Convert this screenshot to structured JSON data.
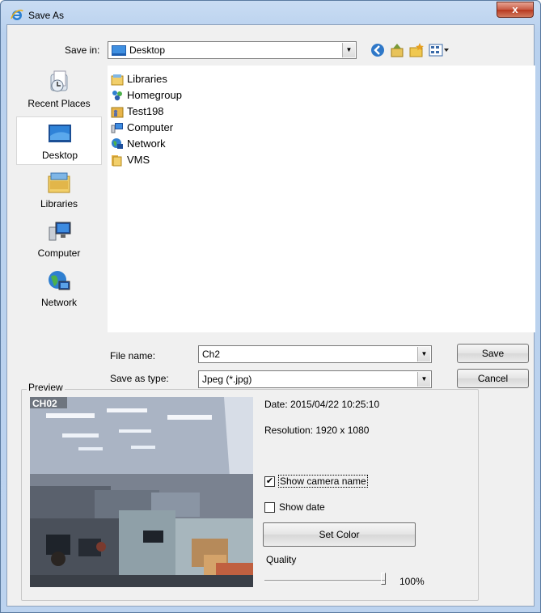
{
  "window": {
    "title": "Save As",
    "close_label": "x"
  },
  "toolbar": {
    "save_in_label": "Save in:",
    "save_in_value": "Desktop",
    "icons": [
      "back-icon",
      "up-folder-icon",
      "new-folder-icon",
      "view-menu-icon"
    ]
  },
  "places": [
    {
      "label": "Recent Places",
      "icon": "recent-places-icon"
    },
    {
      "label": "Desktop",
      "icon": "desktop-icon",
      "selected": true
    },
    {
      "label": "Libraries",
      "icon": "libraries-icon"
    },
    {
      "label": "Computer",
      "icon": "computer-icon"
    },
    {
      "label": "Network",
      "icon": "network-icon"
    }
  ],
  "files": [
    {
      "name": "Libraries",
      "icon": "libraries-icon"
    },
    {
      "name": "Homegroup",
      "icon": "homegroup-icon"
    },
    {
      "name": "Test198",
      "icon": "user-folder-icon"
    },
    {
      "name": "Computer",
      "icon": "computer-icon"
    },
    {
      "name": "Network",
      "icon": "network-icon"
    },
    {
      "name": "VMS",
      "icon": "folder-icon"
    }
  ],
  "form": {
    "file_name_label": "File name:",
    "file_name_value": "Ch2",
    "save_type_label": "Save as type:",
    "save_type_value": "Jpeg (*.jpg)",
    "save_button": "Save",
    "cancel_button": "Cancel"
  },
  "preview": {
    "legend": "Preview",
    "camera_overlay": "CH02",
    "date_text": "Date: 2015/04/22 10:25:10",
    "resolution_text": "Resolution: 1920 x 1080",
    "show_camera_name_label": "Show camera name",
    "show_camera_name_checked": true,
    "show_date_label": "Show date",
    "show_date_checked": false,
    "set_color_button": "Set Color",
    "quality_label": "Quality",
    "quality_value_text": "100%",
    "quality_value": 1.0
  }
}
